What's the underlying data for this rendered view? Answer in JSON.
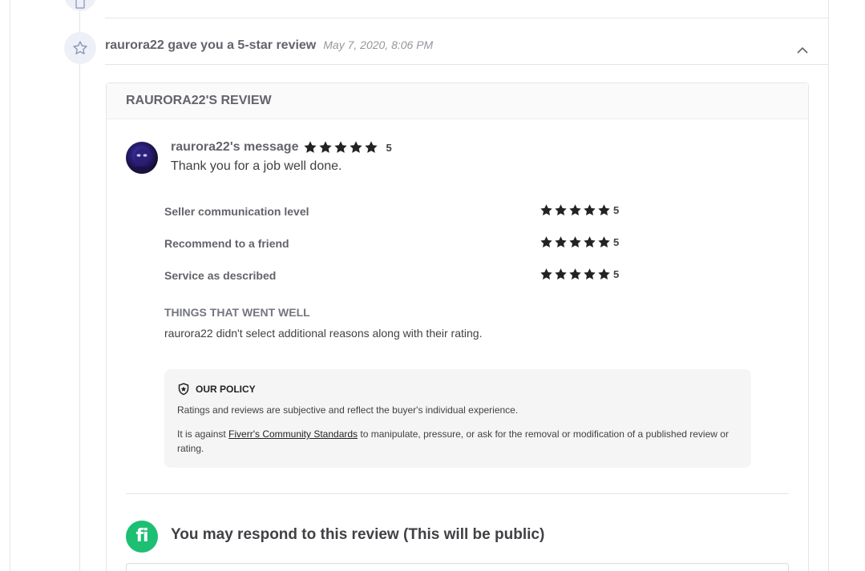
{
  "event": {
    "title": "raurora22 gave you a 5-star review",
    "date": "May 7, 2020, 8:06 PM"
  },
  "review": {
    "heading": "RAURORA22'S REVIEW",
    "message_label": "raurora22's message",
    "overall_score": "5",
    "overall_stars": 5,
    "message": "Thank you for a job well done.",
    "ratings": [
      {
        "label": "Seller communication level",
        "score": "5",
        "stars": 5
      },
      {
        "label": "Recommend to a friend",
        "score": "5",
        "stars": 5
      },
      {
        "label": "Service as described",
        "score": "5",
        "stars": 5
      }
    ],
    "went_well_title": "THINGS THAT WENT WELL",
    "went_well_text": "raurora22 didn't select additional reasons along with their rating."
  },
  "policy": {
    "title": "OUR POLICY",
    "p1": "Ratings and reviews are subjective and reflect the buyer's individual experience.",
    "p2_before": "It is against ",
    "p2_link": "Fiverr's Community Standards",
    "p2_after": " to manipulate, pressure, or ask for the removal or modification of a published review or rating."
  },
  "respond": {
    "title": "You may respond to this review (This will be public)",
    "logo_text": "fi"
  },
  "colors": {
    "brand_green": "#1dbf73",
    "star": "#222325",
    "icon_circle": "#eef0f8"
  }
}
